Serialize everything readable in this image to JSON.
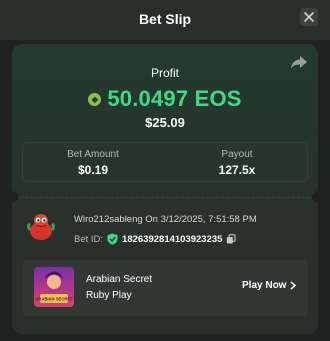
{
  "header": {
    "title": "Bet Slip",
    "close_icon": "close-icon"
  },
  "summary": {
    "profit_label": "Profit",
    "profit_amount": "50.0497 EOS",
    "profit_fiat": "$25.09",
    "coin_icon": "eos-coin-icon",
    "share_icon": "share-icon"
  },
  "stats": {
    "bet_amount_label": "Bet Amount",
    "bet_amount_value": "$0.19",
    "payout_label": "Payout",
    "payout_value": "127.5x"
  },
  "bet": {
    "user_line": "Wiro212sableng On 3/12/2025, 7:51:58 PM",
    "bet_id_label": "Bet ID:",
    "bet_id_value": "1826392814103923235",
    "verified_icon": "verified-shield-icon",
    "copy_icon": "copy-icon"
  },
  "game": {
    "title": "Arabian Secret",
    "provider": "Ruby Play",
    "play_label": "Play Now",
    "thumb_caption": "ARABIAN SECRET"
  },
  "colors": {
    "accent": "#3ddc84",
    "background": "#1f2220",
    "card": "#2b2f2c"
  }
}
